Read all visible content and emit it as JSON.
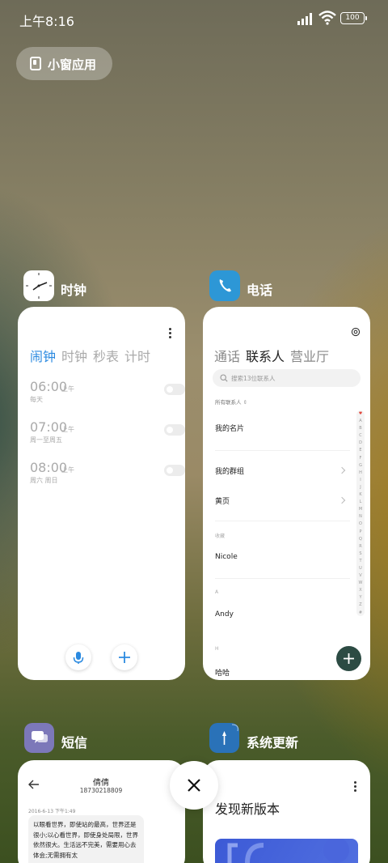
{
  "status": {
    "time": "上午8:16",
    "battery": "100"
  },
  "small_window": {
    "label": "小窗应用"
  },
  "clock": {
    "name": "时钟",
    "tabs": [
      "闹钟",
      "时钟",
      "秒表",
      "计时"
    ],
    "alarms": [
      {
        "time": "06:00",
        "ampm": "上午",
        "days": "每天"
      },
      {
        "time": "07:00",
        "ampm": "上午",
        "days": "周一至周五"
      },
      {
        "time": "08:00",
        "ampm": "上午",
        "days": "周六 周日"
      }
    ]
  },
  "phone": {
    "name": "电话",
    "tabs": [
      "通话",
      "联系人",
      "营业厅"
    ],
    "search_placeholder": "搜索13位联系人",
    "filter": "所有联系人",
    "my_card": "我的名片",
    "my_groups": "我的群组",
    "yellow_pages": "黄页",
    "favorites_header": "收藏",
    "favorite": "Nicole",
    "section_a": "A",
    "contact_a": "Andy",
    "section_h": "H",
    "contact_h": "哈哈",
    "index": [
      "♥",
      "A",
      "B",
      "C",
      "D",
      "E",
      "F",
      "G",
      "H",
      "I",
      "J",
      "K",
      "L",
      "M",
      "N",
      "O",
      "P",
      "Q",
      "R",
      "S",
      "T",
      "U",
      "V",
      "W",
      "X",
      "Y",
      "Z",
      "#"
    ]
  },
  "sms": {
    "name": "短信",
    "contact_name": "倩倩",
    "contact_number": "18730218809",
    "message_time": "2016-6-13 下午1:49",
    "message_text": "以眼看世界，即使站的最高，世界还是很小;以心看世界，即使身处局限，世界依然很大。生活远不完美，需要用心去体会;无需拥有太"
  },
  "update": {
    "name": "系统更新",
    "title": "发现新版本"
  },
  "colors": {
    "clock_accent": "#2b8ae0",
    "phone_icon": "#2d97d6",
    "sms_icon": "#7c78b9",
    "update_icon": "#2a72b8",
    "phone_fab": "#2c4b43"
  }
}
